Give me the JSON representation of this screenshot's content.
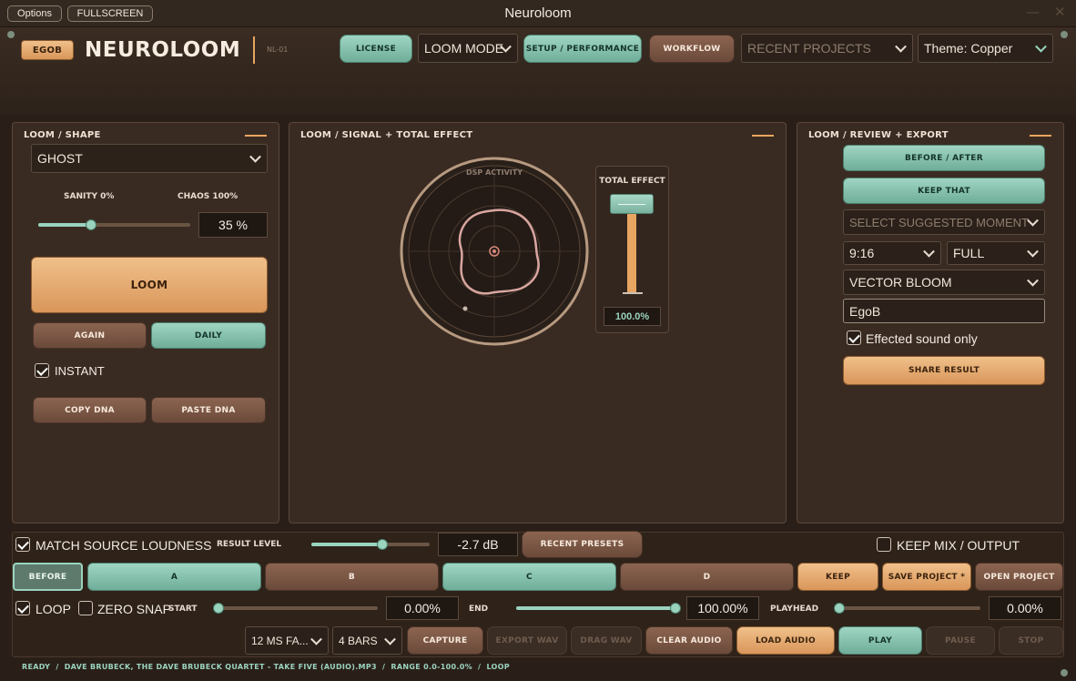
{
  "window": {
    "options": "Options",
    "fullscreen": "FULLSCREEN",
    "title": "Neuroloom",
    "minimize": "—",
    "close": "✕"
  },
  "header": {
    "badge": "EGOB",
    "app_name": "NEUROLOOM",
    "model": "NL-01",
    "license": "LICENSE",
    "loom_mode": "LOOM MODE",
    "setup": "SETUP / PERFORMANCE",
    "workflow": "WORKFLOW",
    "recent_projects": "RECENT PROJECTS",
    "theme": "Theme: Copper"
  },
  "shape_panel": {
    "title": "LOOM  /  SHAPE",
    "preset": "GHOST",
    "sanity_label": "SANITY 0%",
    "chaos_label": "CHAOS 100%",
    "amount": 35,
    "amount_text": "35 %",
    "loom": "LOOM",
    "again": "AGAIN",
    "daily": "DAILY",
    "instant": "INSTANT",
    "instant_checked": true,
    "copy_dna": "COPY DNA",
    "paste_dna": "PASTE DNA"
  },
  "signal_panel": {
    "title": "LOOM  /  SIGNAL + TOTAL EFFECT",
    "dsp_label": "DSP ACTIVITY",
    "total_effect_label": "TOTAL EFFECT",
    "total_effect": 100,
    "total_effect_text": "100.0%"
  },
  "review_panel": {
    "title": "LOOM  /  REVIEW + EXPORT",
    "before_after": "BEFORE / AFTER",
    "keep_that": "KEEP THAT",
    "suggested": "SELECT SUGGESTED MOMENT",
    "aspect": "9:16",
    "framing": "FULL",
    "visual": "VECTOR BLOOM",
    "name": "EgoB",
    "effected_only": "Effected sound only",
    "effected_checked": true,
    "share": "SHARE RESULT"
  },
  "mix": {
    "match_loudness": "MATCH SOURCE LOUDNESS",
    "match_checked": true,
    "result_level_label": "RESULT LEVEL",
    "result_level": 0.6,
    "result_level_text": "-2.7 dB",
    "recent_presets": "RECENT PRESETS",
    "keep_mix": "KEEP MIX / OUTPUT",
    "keep_mix_checked": false
  },
  "slots": {
    "before": "BEFORE",
    "a": "A",
    "b": "B",
    "c": "C",
    "d": "D",
    "keep": "KEEP",
    "save": "SAVE PROJECT *",
    "open": "OPEN PROJECT"
  },
  "transport": {
    "loop": "LOOP",
    "loop_checked": true,
    "zero_snap": "ZERO SNAP",
    "zero_snap_checked": false,
    "start_label": "START",
    "start": 0.0,
    "start_text": "0.00%",
    "end_label": "END",
    "end": 100.0,
    "end_text": "100.00%",
    "playhead_label": "PLAYHEAD",
    "playhead": 0.0,
    "playhead_text": "0.00%",
    "fade": "12 MS FA...",
    "bars": "4 BARS",
    "capture": "CAPTURE",
    "export_wav": "EXPORT WAV",
    "drag_wav": "DRAG WAV",
    "clear_audio": "CLEAR AUDIO",
    "load_audio": "LOAD AUDIO",
    "play": "PLAY",
    "pause": "PAUSE",
    "stop": "STOP"
  },
  "status": "READY  /  DAVE BRUBECK, THE DAVE BRUBECK QUARTET - TAKE FIVE (AUDIO).MP3  /  RANGE 0.0-100.0%  /  LOOP",
  "colors": {
    "accent_teal": "#9ad3be",
    "accent_orange": "#e8a561",
    "background": "#2a1f18",
    "panel": "#3a2b22"
  }
}
